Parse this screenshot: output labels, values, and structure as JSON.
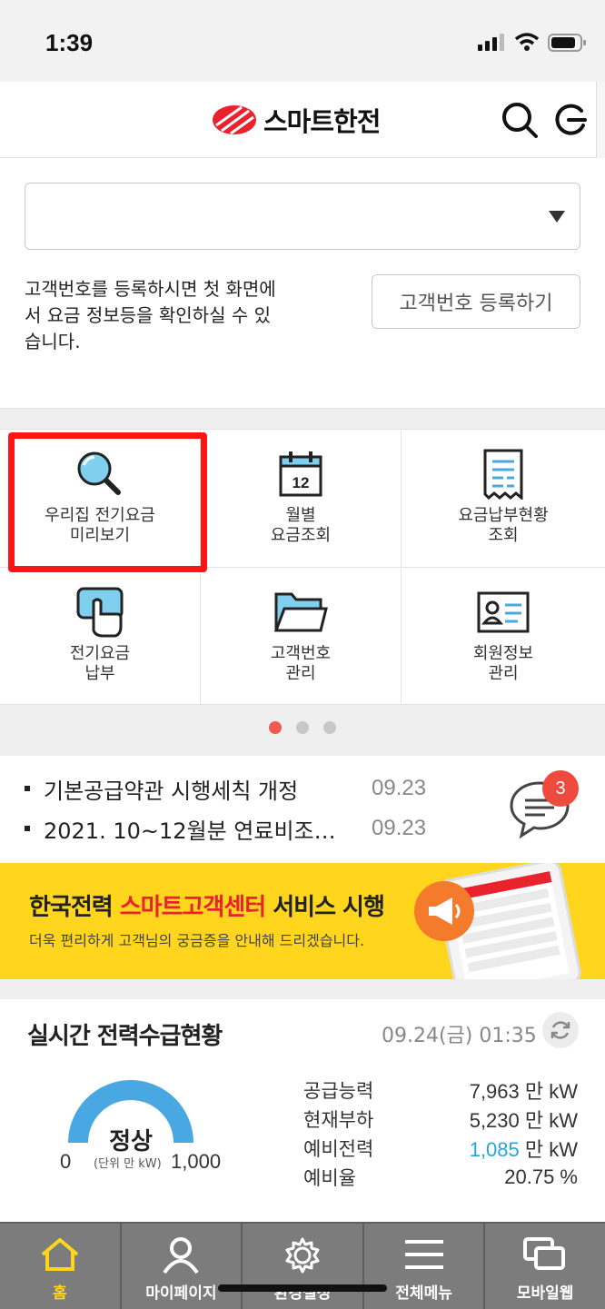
{
  "status_bar": {
    "time": "1:39"
  },
  "header": {
    "app_name": "스마트한전",
    "brand_color": "#e8232e"
  },
  "account": {
    "select_value": "",
    "notice_lines": [
      "고객번호를 등록하시면 첫 화면에",
      "서 요금 정보등을 확인하실 수 있",
      "습니다."
    ],
    "register_button": "고객번호 등록하기"
  },
  "menu": {
    "items": [
      {
        "icon": "magnifier-icon",
        "line1": "우리집 전기요금",
        "line2": "미리보기",
        "highlighted": true
      },
      {
        "icon": "calendar-icon",
        "calendar_day": "12",
        "line1": "월별",
        "line2": "요금조회"
      },
      {
        "icon": "receipt-icon",
        "line1": "요금납부현황",
        "line2": "조회"
      },
      {
        "icon": "payment-hand-icon",
        "line1": "전기요금",
        "line2": "납부"
      },
      {
        "icon": "folder-icon",
        "line1": "고객번호",
        "line2": "관리"
      },
      {
        "icon": "id-card-icon",
        "line1": "회원정보",
        "line2": "관리"
      }
    ],
    "page_indicator": {
      "current": 1,
      "total": 3
    }
  },
  "news": {
    "items": [
      {
        "title": "기본공급약관 시행세칙 개정",
        "date": "09.23"
      },
      {
        "title": "2021. 10~12월분 연료비조…",
        "date": "09.23"
      }
    ],
    "chat_badge": "3"
  },
  "banner": {
    "title_pre": "한국전력 ",
    "title_highlight": "스마트고객센터",
    "title_post": " 서비스 시행",
    "subtitle": "더욱 편리하게 고객님의 궁금증을 안내해 드리겠습니다.",
    "bg_color": "#ffd51e"
  },
  "power": {
    "title": "실시간 전력수급현황",
    "timestamp": "09.24(금) 01:35",
    "gauge": {
      "state": "정상",
      "min": "0",
      "unit": "(단위 만 kW)",
      "max": "1,000",
      "color": "#49a8e2"
    },
    "stats": [
      {
        "label": "공급능력",
        "value": "7,963",
        "unit": " 만 kW"
      },
      {
        "label": "현재부하",
        "value": "5,230",
        "unit": " 만 kW"
      },
      {
        "label": "예비전력",
        "value": "1,085",
        "unit": " 만 kW",
        "highlight": true
      },
      {
        "label": "예비율",
        "value": "20.75",
        "unit": " %"
      }
    ]
  },
  "tabbar": {
    "tabs": [
      {
        "icon": "home-icon",
        "label": "홈",
        "active": true
      },
      {
        "icon": "person-icon",
        "label": "마이페이지"
      },
      {
        "icon": "gear-icon",
        "label": "환경설정"
      },
      {
        "icon": "hamburger-menu-icon",
        "label": "전체메뉴"
      },
      {
        "icon": "mobile-web-icon",
        "label": "모바일웹"
      }
    ]
  }
}
